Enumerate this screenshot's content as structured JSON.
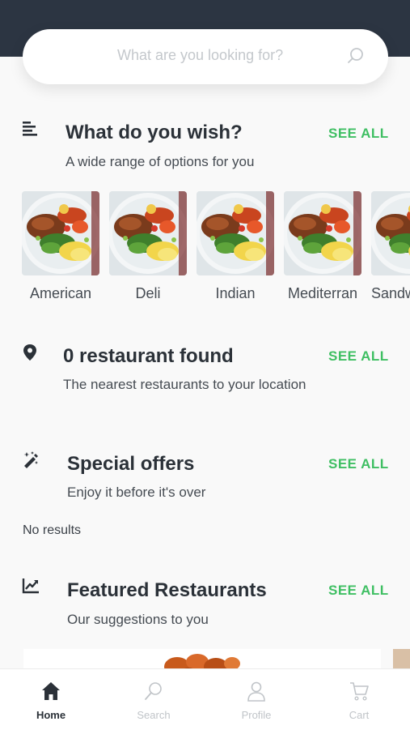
{
  "search": {
    "placeholder": "What are you looking for?",
    "icon": "search-icon"
  },
  "wish": {
    "title": "What do you wish?",
    "subtitle": "A wide range of options for you",
    "see_all": "SEE ALL",
    "icon": "menu-lines-icon"
  },
  "categories": [
    {
      "label": "American"
    },
    {
      "label": "Deli"
    },
    {
      "label": "Indian"
    },
    {
      "label": "Mediterran"
    },
    {
      "label": "Sandw"
    }
  ],
  "restaurants": {
    "title": "0 restaurant found",
    "subtitle": "The nearest restaurants to your location",
    "see_all": "SEE ALL",
    "icon": "location-pin-icon"
  },
  "offers": {
    "title": "Special offers",
    "subtitle": "Enjoy it before it's over",
    "see_all": "SEE ALL",
    "empty": "No results",
    "icon": "magic-wand-icon"
  },
  "featured": {
    "title": "Featured Restaurants",
    "subtitle": "Our suggestions to you",
    "see_all": "SEE ALL",
    "icon": "trending-chart-icon"
  },
  "nav": {
    "items": [
      {
        "label": "Home",
        "icon": "home-icon",
        "active": true
      },
      {
        "label": "Search",
        "icon": "search-icon",
        "active": false
      },
      {
        "label": "Profile",
        "icon": "profile-icon",
        "active": false
      },
      {
        "label": "Cart",
        "icon": "cart-icon",
        "active": false
      }
    ]
  },
  "colors": {
    "header": "#2c3542",
    "accent": "#3fbf63",
    "text": "#2b3138"
  }
}
